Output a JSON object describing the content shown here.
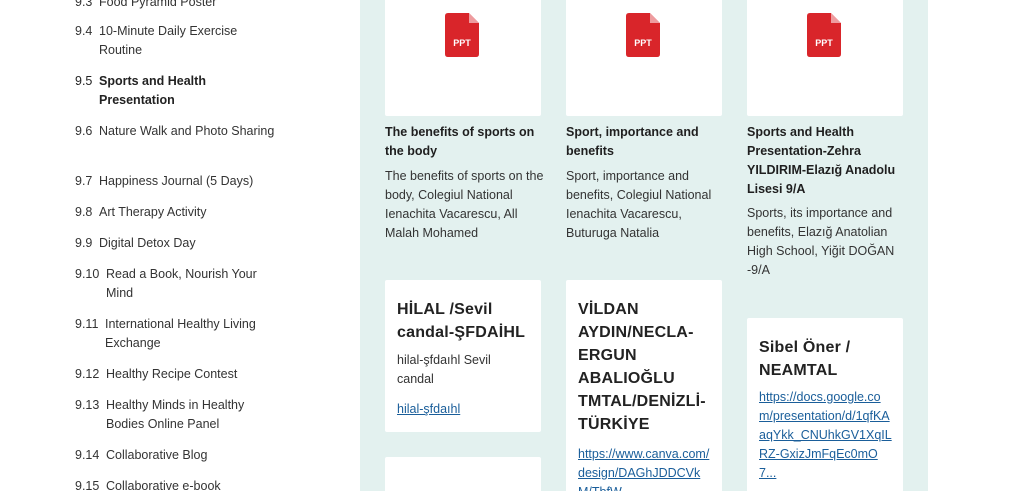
{
  "sidebar": {
    "items": [
      {
        "num": "9.3",
        "label": "Food Pyramid Poster"
      },
      {
        "num": "9.4",
        "label": "10-Minute Daily Exercise Routine"
      },
      {
        "num": "9.5",
        "label": "Sports and Health Presentation"
      },
      {
        "num": "9.6",
        "label": "Nature Walk and Photo Sharing"
      },
      {
        "num": "9.7",
        "label": "Happiness Journal (5 Days)"
      },
      {
        "num": "9.8",
        "label": "Art Therapy Activity"
      },
      {
        "num": "9.9",
        "label": "Digital Detox Day"
      },
      {
        "num": "9.10",
        "label": "Read a Book, Nourish Your Mind"
      },
      {
        "num": "9.11",
        "label": "International Healthy Living Exchange"
      },
      {
        "num": "9.12",
        "label": "Healthy Recipe Contest"
      },
      {
        "num": "9.13",
        "label": "Healthy Minds in Healthy Bodies Online Panel"
      },
      {
        "num": "9.14",
        "label": "Collaborative Blog"
      },
      {
        "num": "9.15",
        "label": "Collaborative e-book"
      }
    ]
  },
  "files": [
    {
      "icon_label": "PPT",
      "title": "The benefits of sports on the body",
      "description": "The benefits of sports on the body, Colegiul National Ienachita Vacarescu, All Malah Mohamed"
    },
    {
      "icon_label": "PPT",
      "title": "Sport, importance and benefits",
      "description": "Sport, importance and benefits, Colegiul National Ienachita Vacarescu, Buturuga Natalia"
    },
    {
      "icon_label": "PPT",
      "title": "Sports and Health Presentation-Zehra YILDIRIM-Elazığ Anadolu Lisesi 9/A",
      "description": "Sports, its importance and benefits, Elazığ Anatolian High School, Yiğit DOĞAN -9/A"
    }
  ],
  "links": [
    {
      "title": "HİLAL /Sevil candal-ŞFDAİHL",
      "description": "hilal-şfdaıhl Sevil candal",
      "link": "hilal-şfdaıhl"
    },
    {
      "title": "VİLDAN AYDIN/NECLA-ERGUN ABALIOĞLU TMTAL/DENİZLİ-TÜRKİYE",
      "link": "https://www.canva.com/design/DAGhJDDCVkM/TbfW..."
    },
    {
      "title": "Sibel Öner / NEAMTAL",
      "link": "https://docs.google.com/presentation/d/1qfKAaqYkk_CNUhkGV1XqILRZ-GxizJmFqEc0mO7..."
    }
  ],
  "colors": {
    "main_bg": "#e3f1ef",
    "ppt_icon": "#d9252a",
    "link": "#1a5e9a"
  }
}
